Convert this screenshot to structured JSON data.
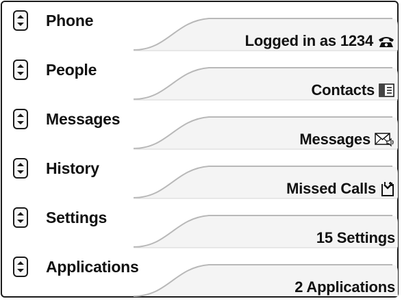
{
  "rows": [
    {
      "label": "Phone",
      "value": "Logged in as 1234",
      "icon": "phone-icon"
    },
    {
      "label": "People",
      "value": "Contacts",
      "icon": "contacts-icon"
    },
    {
      "label": "Messages",
      "value": "Messages",
      "icon": "voicemail-icon"
    },
    {
      "label": "History",
      "value": "Missed Calls",
      "icon": "missed-call-icon"
    },
    {
      "label": "Settings",
      "value": "15 Settings",
      "icon": ""
    },
    {
      "label": "Applications",
      "value": "2 Applications",
      "icon": ""
    }
  ],
  "colors": {
    "border": "#1a1a1a",
    "text": "#111111",
    "tab_line": "#b8b8b8",
    "tab_fill": "#f4f4f4"
  }
}
